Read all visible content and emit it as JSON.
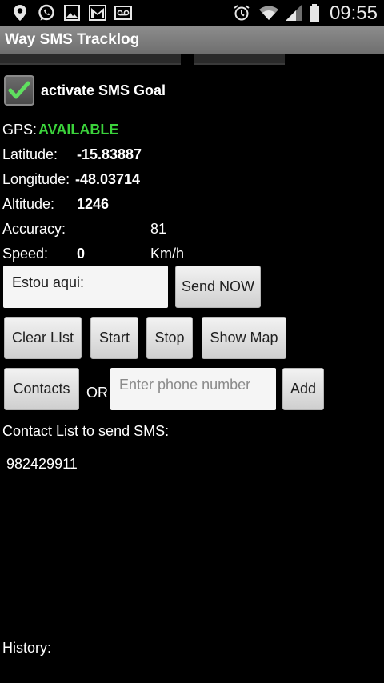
{
  "status_bar": {
    "time": "09:55",
    "left_icons": [
      "location-icon",
      "whatsapp-icon",
      "image-icon",
      "gmail-icon",
      "voicemail-icon"
    ],
    "right_icons": [
      "alarm-icon",
      "wifi-icon",
      "signal-icon",
      "battery-icon"
    ]
  },
  "app": {
    "title": "Way SMS Tracklog"
  },
  "sms_goal": {
    "label": "activate SMS Goal",
    "checked": true
  },
  "gps": {
    "label": "GPS:",
    "status": "AVAILABLE",
    "status_color": "#3bd23b",
    "latitude_label": "Latitude:",
    "latitude": "-15.83887",
    "longitude_label": "Longitude:",
    "longitude": "-48.03714",
    "altitude_label": "Altitude:",
    "altitude": "1246",
    "accuracy_label": "Accuracy:",
    "accuracy": "81",
    "speed_label": "Speed:",
    "speed": "0",
    "speed_unit": "Km/h"
  },
  "message": {
    "value": "Estou aqui:",
    "send_label": "Send NOW"
  },
  "controls": {
    "clear_label": "Clear LIst",
    "start_label": "Start",
    "stop_label": "Stop",
    "map_label": "Show Map"
  },
  "contacts": {
    "contacts_label": "Contacts",
    "or_label": "OR",
    "phone_placeholder": "Enter phone number",
    "add_label": "Add",
    "list_title": "Contact List to send SMS:",
    "items": [
      "982429911"
    ]
  },
  "history": {
    "label": "History:"
  }
}
